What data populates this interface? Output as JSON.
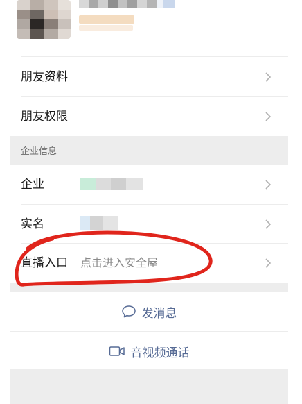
{
  "friend_info_label": "朋友资料",
  "friend_permission_label": "朋友权限",
  "enterprise_section_title": "企业信息",
  "enterprise_label": "企业",
  "real_name_label": "实名",
  "live_entry": {
    "label": "直播入口",
    "value": "点击进入安全屋"
  },
  "actions": {
    "send_message": "发消息",
    "video_call": "音视频通话"
  },
  "colors": {
    "link_blue": "#576b95",
    "annotation_red": "#e0251c",
    "section_gray": "#ededed"
  },
  "icons": {
    "chevron": "chevron-right-icon",
    "message": "chat-bubble-icon",
    "video": "video-camera-icon"
  }
}
